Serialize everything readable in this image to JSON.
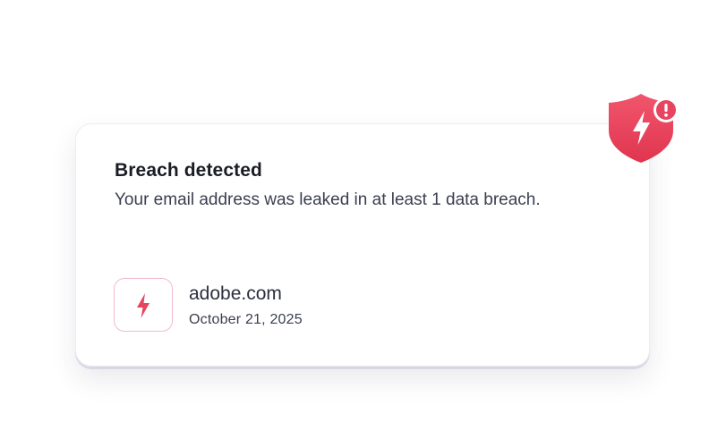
{
  "card": {
    "title": "Breach detected",
    "description": "Your email address was leaked in at least 1 data breach."
  },
  "breaches": [
    {
      "domain": "adobe.com",
      "date": "October 21, 2025",
      "icon": "lightning-icon"
    }
  ],
  "badge": {
    "icon": "shield-lightning-icon",
    "alert_icon": "exclamation-icon"
  },
  "colors": {
    "accent": "#e8435f",
    "accent_light": "#f2bccb",
    "title_text": "#1b1d26",
    "body_text": "#3a3e4f"
  }
}
